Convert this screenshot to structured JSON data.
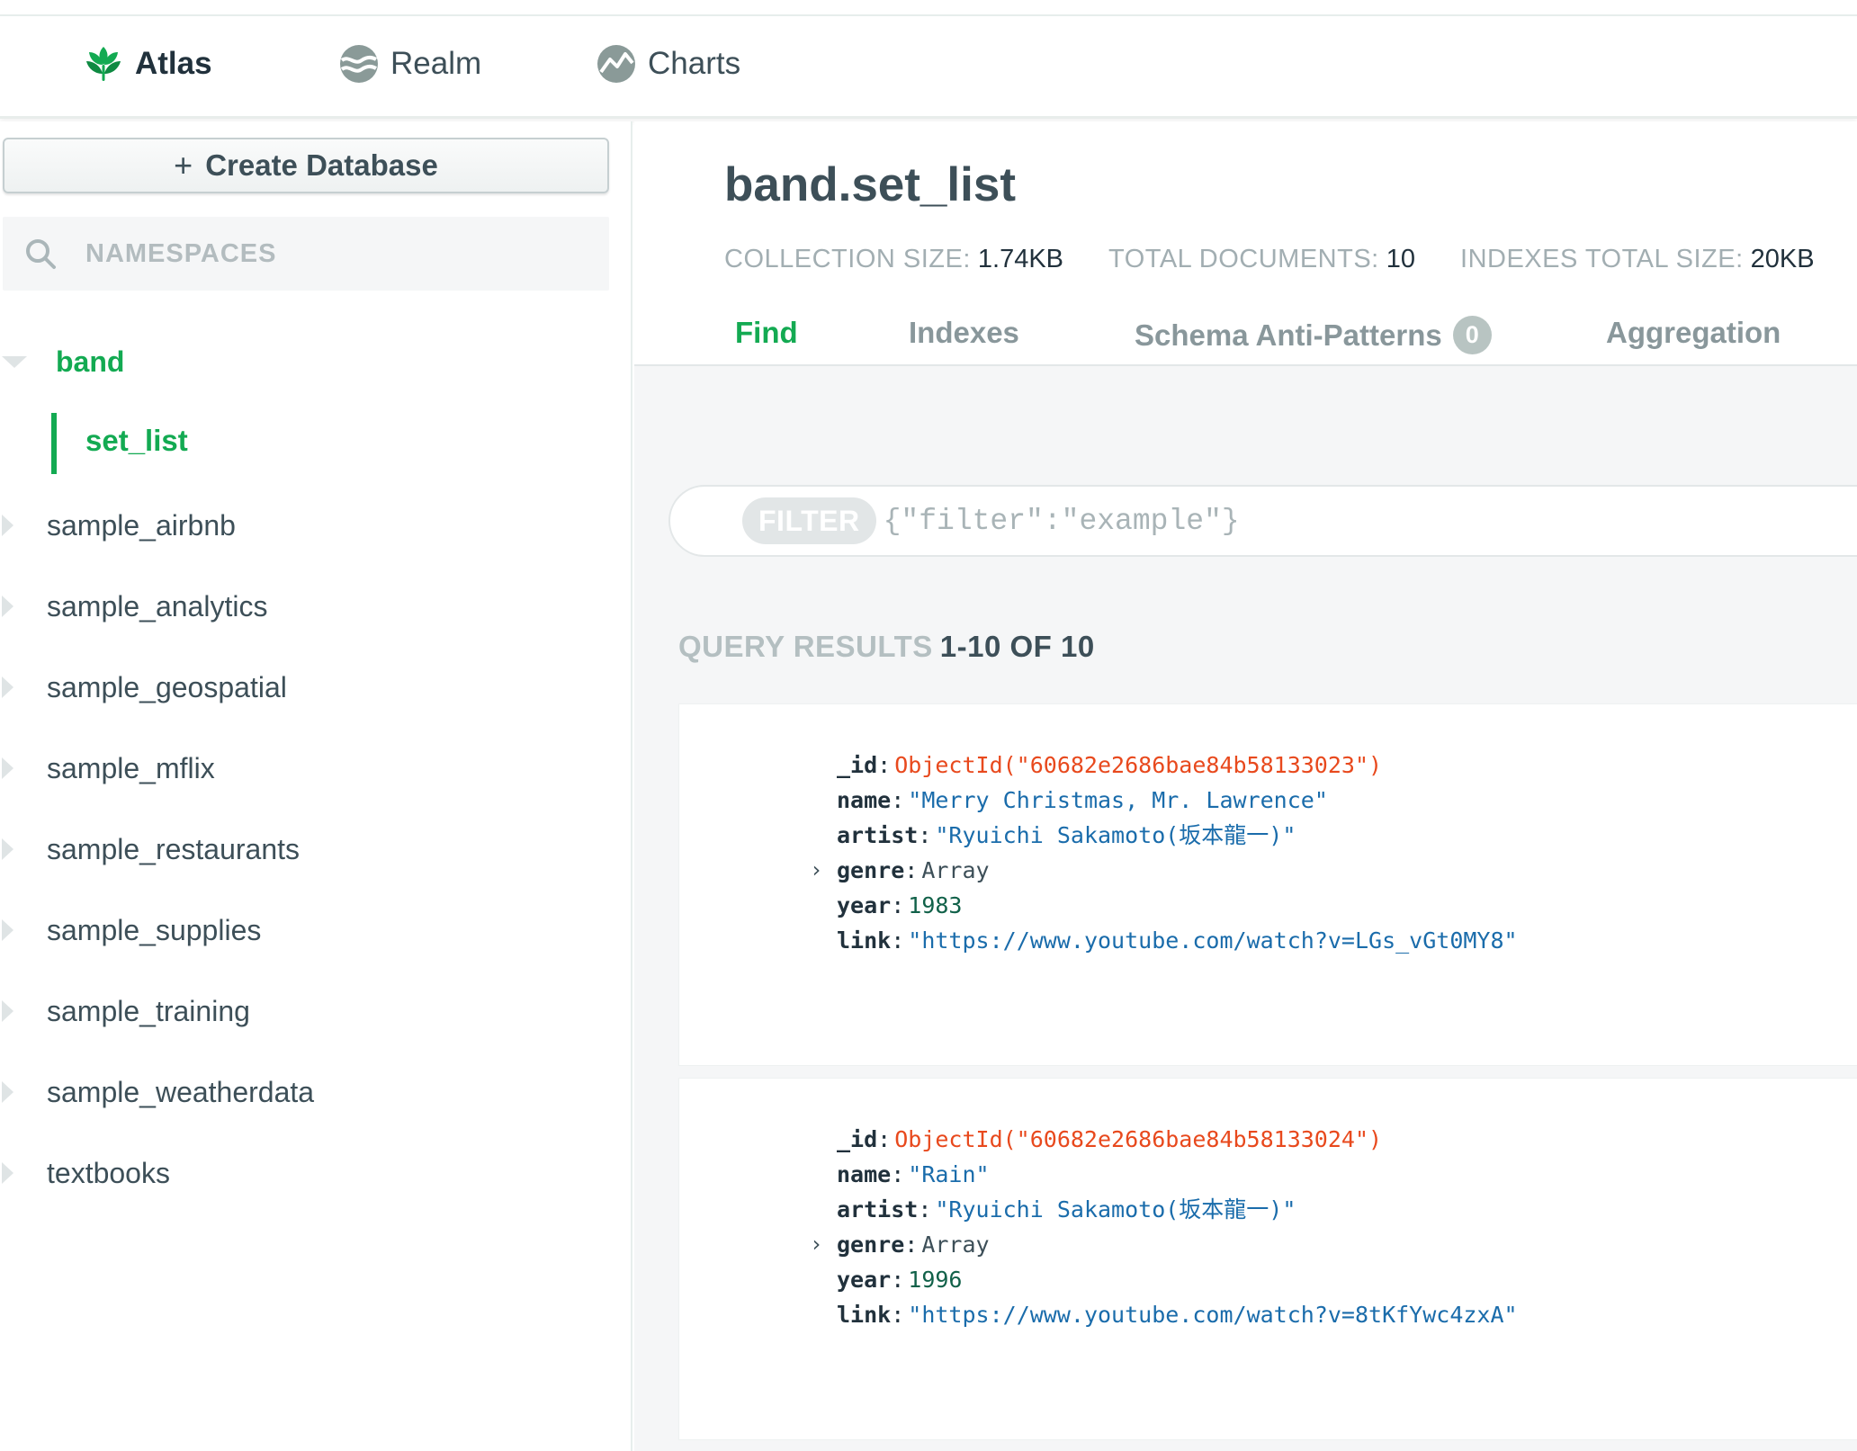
{
  "top_nav": {
    "products": [
      {
        "label": "Atlas",
        "icon": "atlas-leaf-icon",
        "active": true
      },
      {
        "label": "Realm",
        "icon": "realm-icon",
        "active": false
      },
      {
        "label": "Charts",
        "icon": "charts-icon",
        "active": false
      }
    ]
  },
  "sidebar": {
    "create_database_label": "Create Database",
    "search_placeholder": "NAMESPACES",
    "databases": [
      {
        "name": "band",
        "expanded": true,
        "collections": [
          "set_list"
        ]
      },
      {
        "name": "sample_airbnb"
      },
      {
        "name": "sample_analytics"
      },
      {
        "name": "sample_geospatial"
      },
      {
        "name": "sample_mflix"
      },
      {
        "name": "sample_restaurants"
      },
      {
        "name": "sample_supplies"
      },
      {
        "name": "sample_training"
      },
      {
        "name": "sample_weatherdata"
      },
      {
        "name": "textbooks"
      }
    ]
  },
  "collection": {
    "title": "band.set_list",
    "stats": [
      {
        "label": "COLLECTION SIZE:",
        "value": "1.74KB"
      },
      {
        "label": "TOTAL DOCUMENTS:",
        "value": "10"
      },
      {
        "label": "INDEXES TOTAL SIZE:",
        "value": "20KB"
      }
    ],
    "tabs": [
      {
        "label": "Find",
        "active": true
      },
      {
        "label": "Indexes",
        "active": false
      },
      {
        "label": "Schema Anti-Patterns",
        "badge": "0",
        "active": false
      },
      {
        "label": "Aggregation",
        "active": false
      }
    ]
  },
  "filter": {
    "label": "FILTER",
    "placeholder": "{\"filter\":\"example\"}"
  },
  "query_results": {
    "label": "QUERY RESULTS",
    "count": "1-10 OF 10"
  },
  "documents": [
    {
      "fields": [
        {
          "key": "_id",
          "value": "ObjectId(\"60682e2686bae84b58133023\")"
        },
        {
          "key": "name",
          "value": "\"Merry Christmas, Mr. Lawrence\""
        },
        {
          "key": "artist",
          "value": "\"Ryuichi Sakamoto(坂本龍一)\""
        },
        {
          "key": "genre",
          "value": "Array"
        },
        {
          "key": "year",
          "value": "1983"
        },
        {
          "key": "link",
          "value": "\"https://www.youtube.com/watch?v=LGs_vGt0MY8\""
        }
      ]
    },
    {
      "fields": [
        {
          "key": "_id",
          "value": "ObjectId(\"60682e2686bae84b58133024\")"
        },
        {
          "key": "name",
          "value": "\"Rain\""
        },
        {
          "key": "artist",
          "value": "\"Ryuichi Sakamoto(坂本龍一)\""
        },
        {
          "key": "genre",
          "value": "Array"
        },
        {
          "key": "year",
          "value": "1996"
        },
        {
          "key": "link",
          "value": "\"https://www.youtube.com/watch?v=8tKfYwc4zxA\""
        }
      ]
    }
  ],
  "colors": {
    "brand_green": "#13aa52",
    "object_id": "#e8491d",
    "string": "#1a6cab",
    "number": "#116149"
  }
}
